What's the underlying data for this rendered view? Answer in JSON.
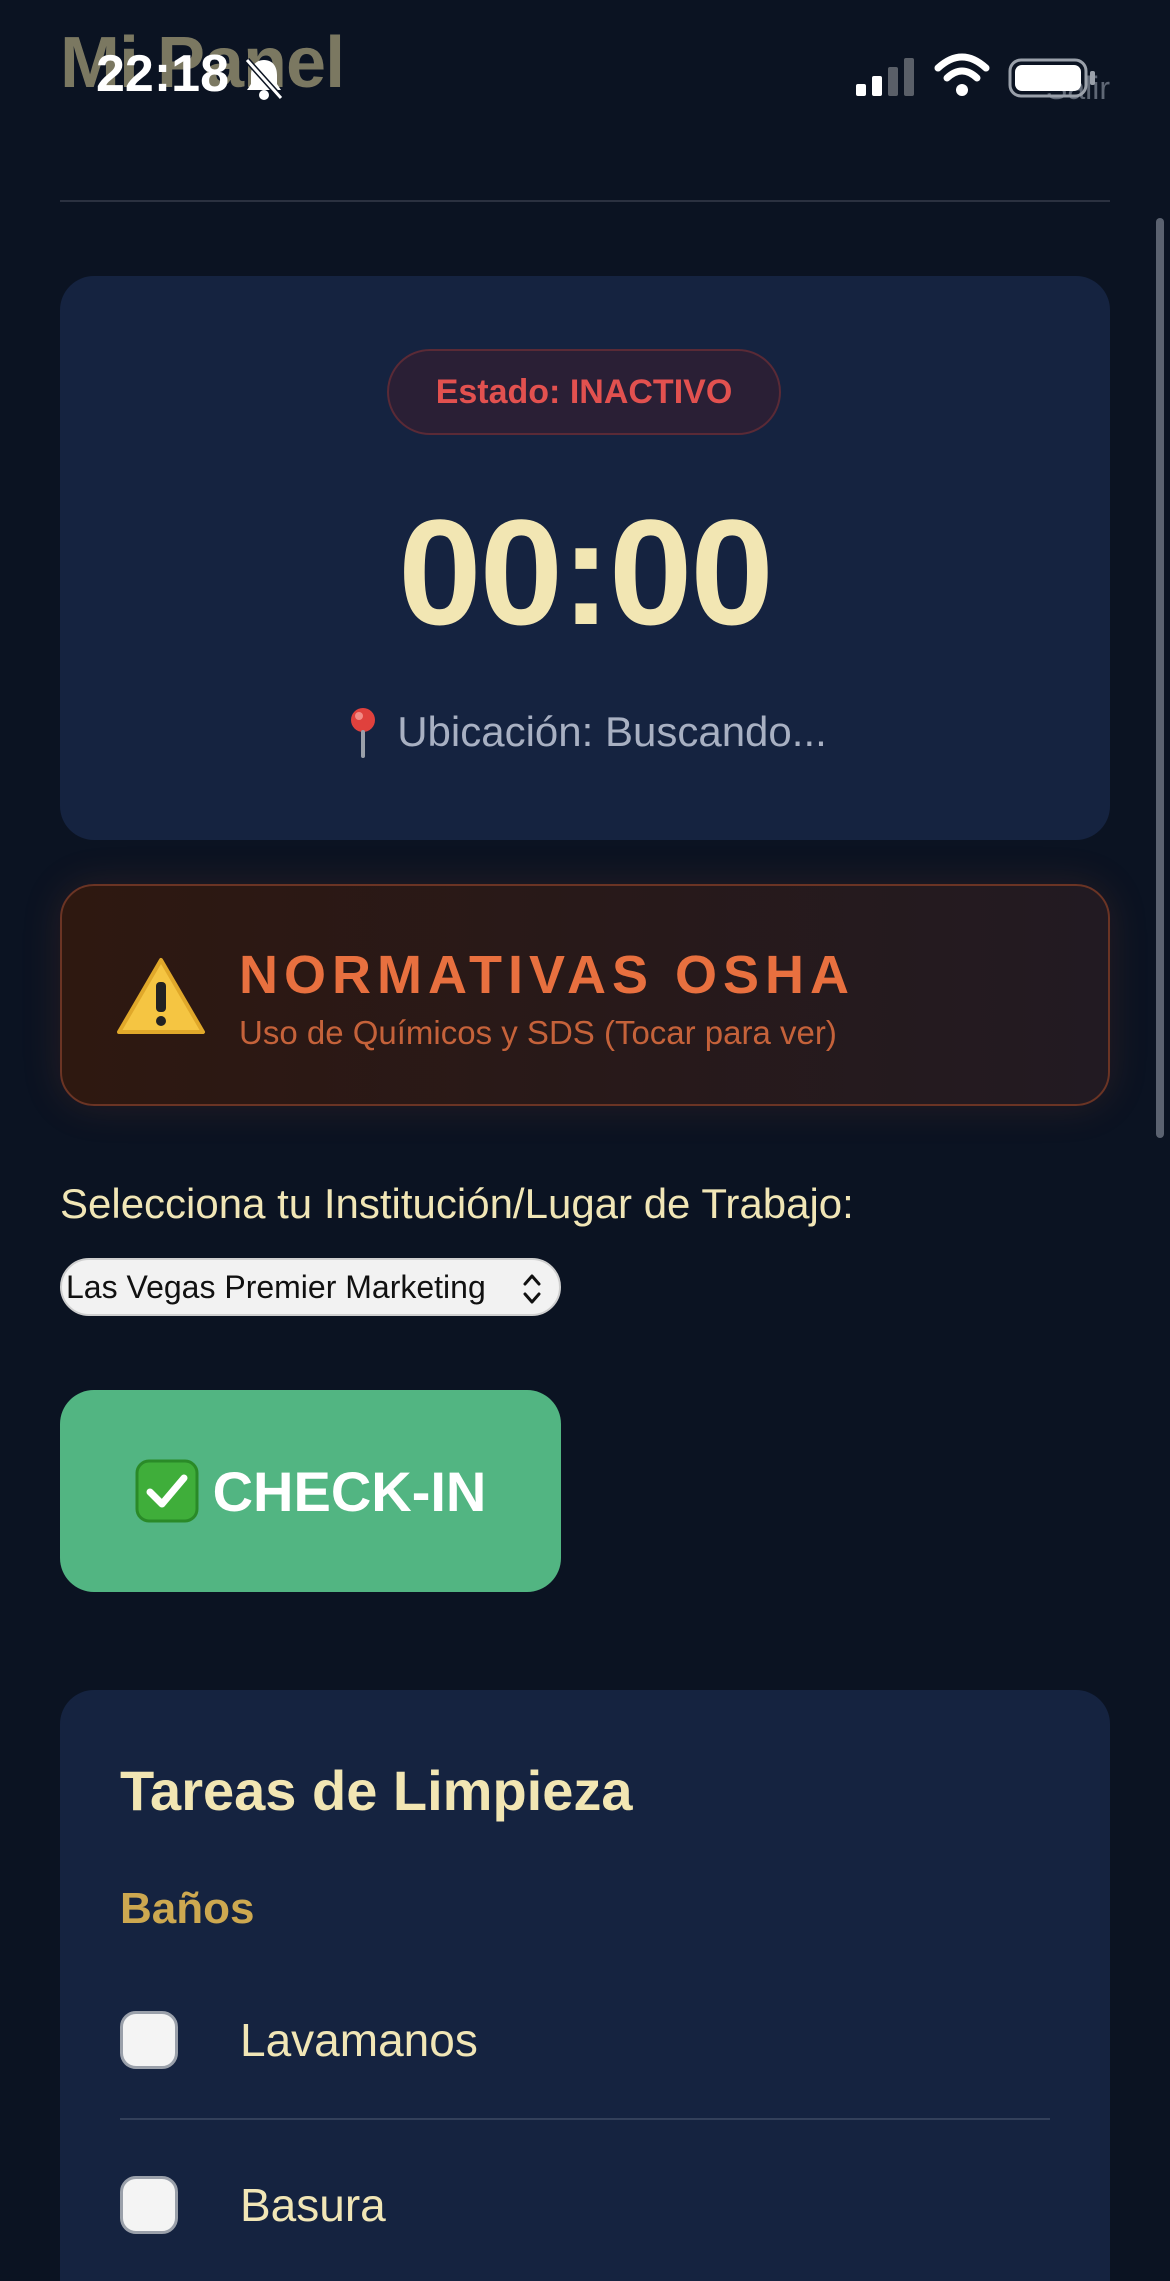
{
  "header": {
    "app_title": "Mi Panel",
    "logout_label": "Salir"
  },
  "status_bar": {
    "time": "22:18"
  },
  "timer_card": {
    "status": "Estado: INACTIVO",
    "timer": "00:00",
    "location": "Ubicación: Buscando..."
  },
  "osha": {
    "title": "NORMATIVAS OSHA",
    "subtitle": "Uso de Químicos y SDS (Tocar para ver)"
  },
  "workplace": {
    "label": "Selecciona tu Institución/Lugar de Trabajo:",
    "selected": "Las Vegas Premier Marketing"
  },
  "checkin": {
    "label": "CHECK-IN"
  },
  "tasks": {
    "title": "Tareas de Limpieza",
    "section": "Baños",
    "items": [
      {
        "label": "Lavamanos",
        "checked": false
      },
      {
        "label": "Basura",
        "checked": false
      }
    ]
  },
  "colors": {
    "background": "#0b1322",
    "card": "#152340",
    "accent_text": "#f2e6b3",
    "status_inactive": "#e2514f",
    "osha_orange": "#e8703f",
    "checkin_green": "#52b582",
    "section_gold": "#cda850"
  }
}
